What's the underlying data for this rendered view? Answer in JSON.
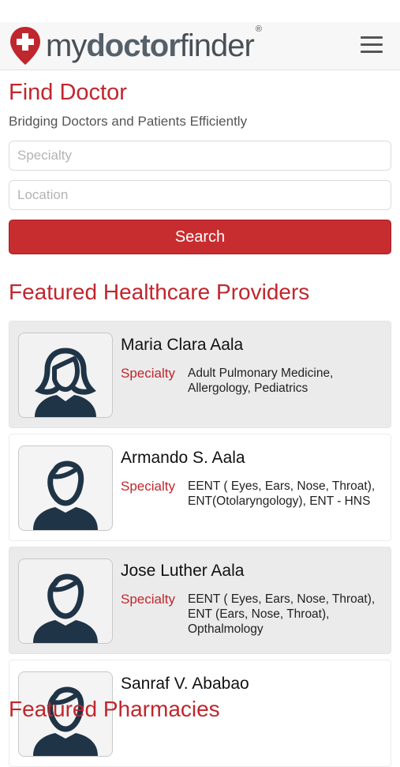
{
  "brand": {
    "name_prefix": "my",
    "name_middle": "doctor",
    "name_suffix": "finder",
    "registered": "®"
  },
  "find": {
    "title": "Find Doctor",
    "subtitle": "Bridging Doctors and Patients Efficiently",
    "specialty_placeholder": "Specialty",
    "location_placeholder": "Location",
    "search_label": "Search"
  },
  "featured": {
    "title": "Featured Healthcare Providers",
    "specialty_label": "Specialty",
    "doctors": [
      {
        "name": "Maria Clara Aala",
        "specialty": "Adult Pulmonary Medicine, Allergology, Pediatrics",
        "avatar": "female"
      },
      {
        "name": "Armando S. Aala",
        "specialty": "EENT ( Eyes,  Ears,  Nose, Throat), ENT(Otolaryngology), ENT - HNS",
        "avatar": "male"
      },
      {
        "name": "Jose Luther Aala",
        "specialty": "EENT ( Eyes,  Ears,  Nose, Throat), ENT (Ears,  Nose, Throat), Opthalmology",
        "avatar": "male"
      },
      {
        "name": "Sanraf V. Ababao",
        "specialty": "",
        "avatar": "male"
      }
    ]
  },
  "next_section_title": "Featured Pharmacies",
  "colors": {
    "brand_red": "#c0262d",
    "button_red": "#c72d2f",
    "avatar_navy": "#1f3446"
  }
}
